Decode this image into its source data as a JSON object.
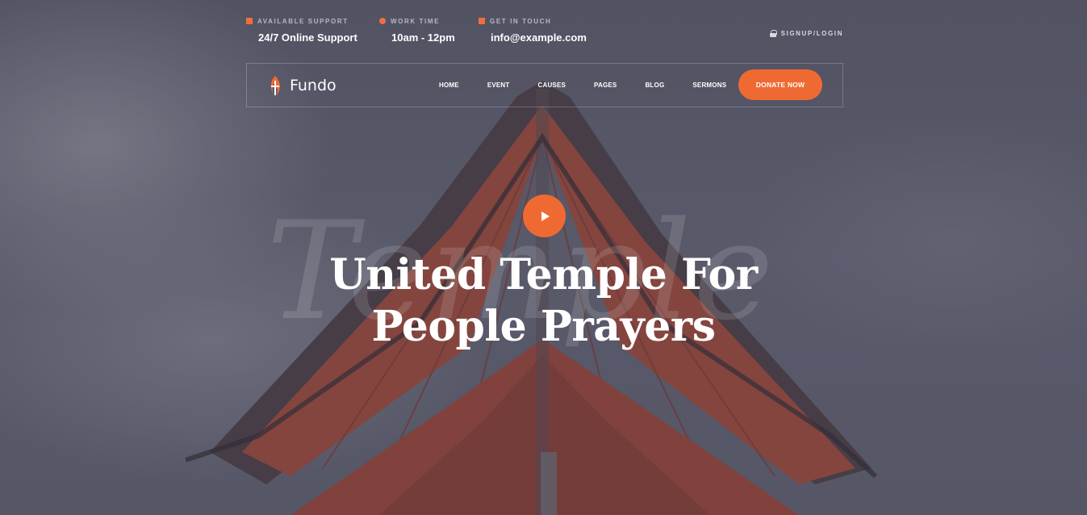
{
  "topbar": {
    "support": {
      "caption": "AVAILABLE SUPPORT",
      "value": "24/7 Online Support"
    },
    "work": {
      "caption": "WORK TIME",
      "value": "10am - 12pm"
    },
    "touch": {
      "caption": "GET IN TOUCH",
      "value": "info@example.com"
    },
    "signup": "SIGNUP/LOGIN"
  },
  "logo": {
    "text": "Fundo"
  },
  "nav": {
    "items": [
      {
        "label": "HOME"
      },
      {
        "label": "EVENT"
      },
      {
        "label": "CAUSES"
      },
      {
        "label": "PAGES"
      },
      {
        "label": "BLOG"
      },
      {
        "label": "SERMONS"
      }
    ],
    "donate": "DONATE NOW"
  },
  "hero": {
    "watermark": "Temple",
    "title_line1": "United Temple For",
    "title_line2": "People Prayers"
  },
  "colors": {
    "accent": "#ef6a33",
    "overlay": "#5d5e6e"
  }
}
